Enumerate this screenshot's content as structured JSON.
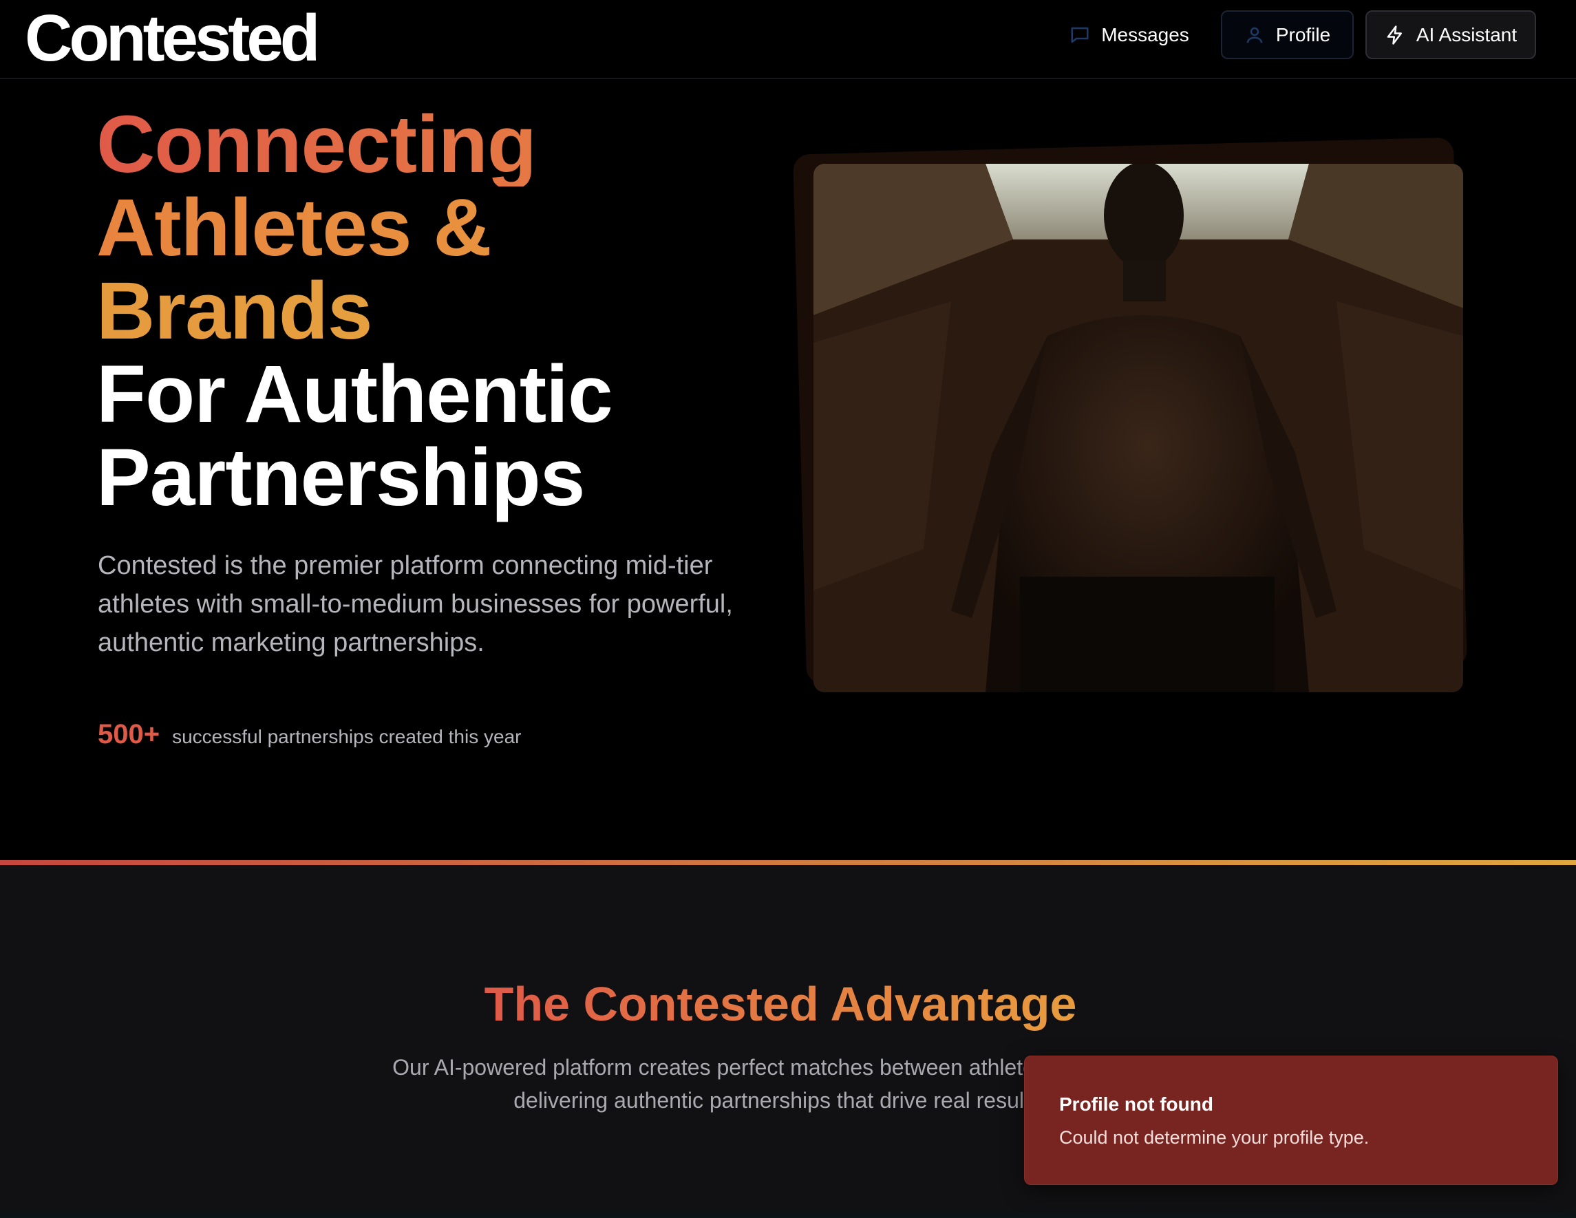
{
  "header": {
    "logo": "Contested",
    "nav": {
      "messages_label": "Messages",
      "profile_label": "Profile",
      "ai_label": "AI Assistant"
    },
    "icons": {
      "messages": "message-square-icon",
      "profile": "user-icon",
      "ai": "lightning-bolt-icon"
    }
  },
  "hero": {
    "title_line1": "Connecting",
    "title_line2": "Athletes &",
    "title_line3": "Brands",
    "title_line4": "For Authentic",
    "title_line5": "Partnerships",
    "description": "Contested is the premier platform connecting mid-tier athletes with small-to-medium businesses for powerful, authentic marketing partnerships.",
    "stat_value": "500+",
    "stat_label": "successful partnerships created this year",
    "image": "athlete-photo"
  },
  "advantage": {
    "title": "The Contested Advantage",
    "description": "Our AI-powered platform creates perfect matches between athletes and brands, delivering authentic partnerships that drive real results."
  },
  "toast": {
    "title": "Profile not found",
    "message": "Could not determine your profile type."
  },
  "colors": {
    "background": "#000000",
    "accent_red": "#e05a48",
    "accent_orange": "#e89c3e",
    "section_bg": "#111113",
    "toast_bg": "#782420"
  }
}
